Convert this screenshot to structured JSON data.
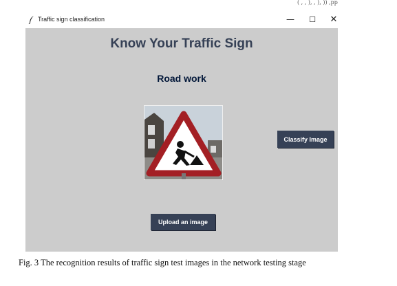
{
  "page": {
    "corner_text": "( ,  ,  ),  ,  ),  )) ,pp",
    "caption": "Fig. 3 The recognition results of traffic sign test images in the network testing stage"
  },
  "window": {
    "title": "Traffic sign classification",
    "icon": "feather-icon",
    "controls": {
      "minimize": "—",
      "maximize": "☐",
      "close": "✕"
    },
    "background": "#cccccc"
  },
  "app": {
    "heading": "Know Your Traffic Sign",
    "result_label": "Road work",
    "image": {
      "icon": "road-work-sign-photo"
    },
    "classify_button": "Classify Image",
    "upload_button": "Upload an image",
    "button_color": "#364156",
    "heading_color": "#364156",
    "result_color": "#011638"
  }
}
